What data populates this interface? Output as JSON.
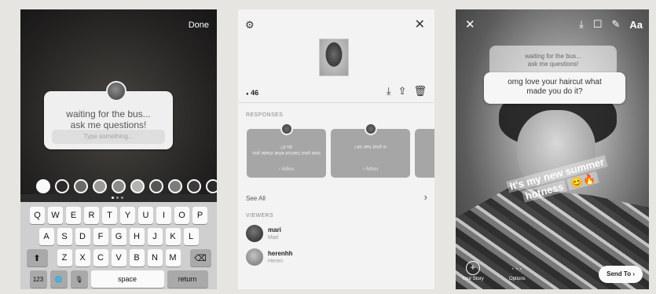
{
  "panel1": {
    "done_label": "Done",
    "question": "waiting for the bus...\nask me questions!",
    "input_placeholder": "Type something...",
    "swatches": [
      "#fafafa",
      "#2b2b2b",
      "#6a6a6a",
      "#9a9a9a",
      "#8a8a8a",
      "#b3b3b3",
      "#555555",
      "#7c7c7c",
      "#3c3c3c",
      "#2a2a2a"
    ],
    "keyboard": {
      "row1": [
        "Q",
        "W",
        "E",
        "R",
        "T",
        "Y",
        "U",
        "I",
        "O",
        "P"
      ],
      "row2": [
        "A",
        "S",
        "D",
        "F",
        "G",
        "H",
        "J",
        "K",
        "L"
      ],
      "row3": [
        "Z",
        "X",
        "C",
        "V",
        "B",
        "N",
        "M"
      ],
      "shift": "⬆",
      "backspace": "⌫",
      "numbers": "123",
      "globe": "🌐",
      "mic": "🎙",
      "space": "space",
      "return": "return"
    }
  },
  "panel2": {
    "view_count": "46",
    "view_icon": "●",
    "responses_title": "RESPONSES",
    "responses": [
      {
        "text": "love your haircut what made you do it?",
        "link": "Reply ›"
      },
      {
        "text": "is your hair ok?",
        "link": "Reply ›"
      }
    ],
    "see_all": "See All",
    "viewers_title": "VIEWERS",
    "viewers": [
      {
        "name": "mari",
        "sub": "Mari"
      },
      {
        "name": "herenhh",
        "sub": "Heren"
      }
    ]
  },
  "panel3": {
    "question": "waiting for the bus...\nask me questions!",
    "reply": "omg love your haircut what\nmade you do it?",
    "caption_line1": "It's my new summer",
    "caption_line2": "hotness",
    "caption_emoji": "😊🔥",
    "your_story": "Your Story",
    "options": "Options",
    "send_to": "Send To",
    "text_tool": "Aa"
  }
}
